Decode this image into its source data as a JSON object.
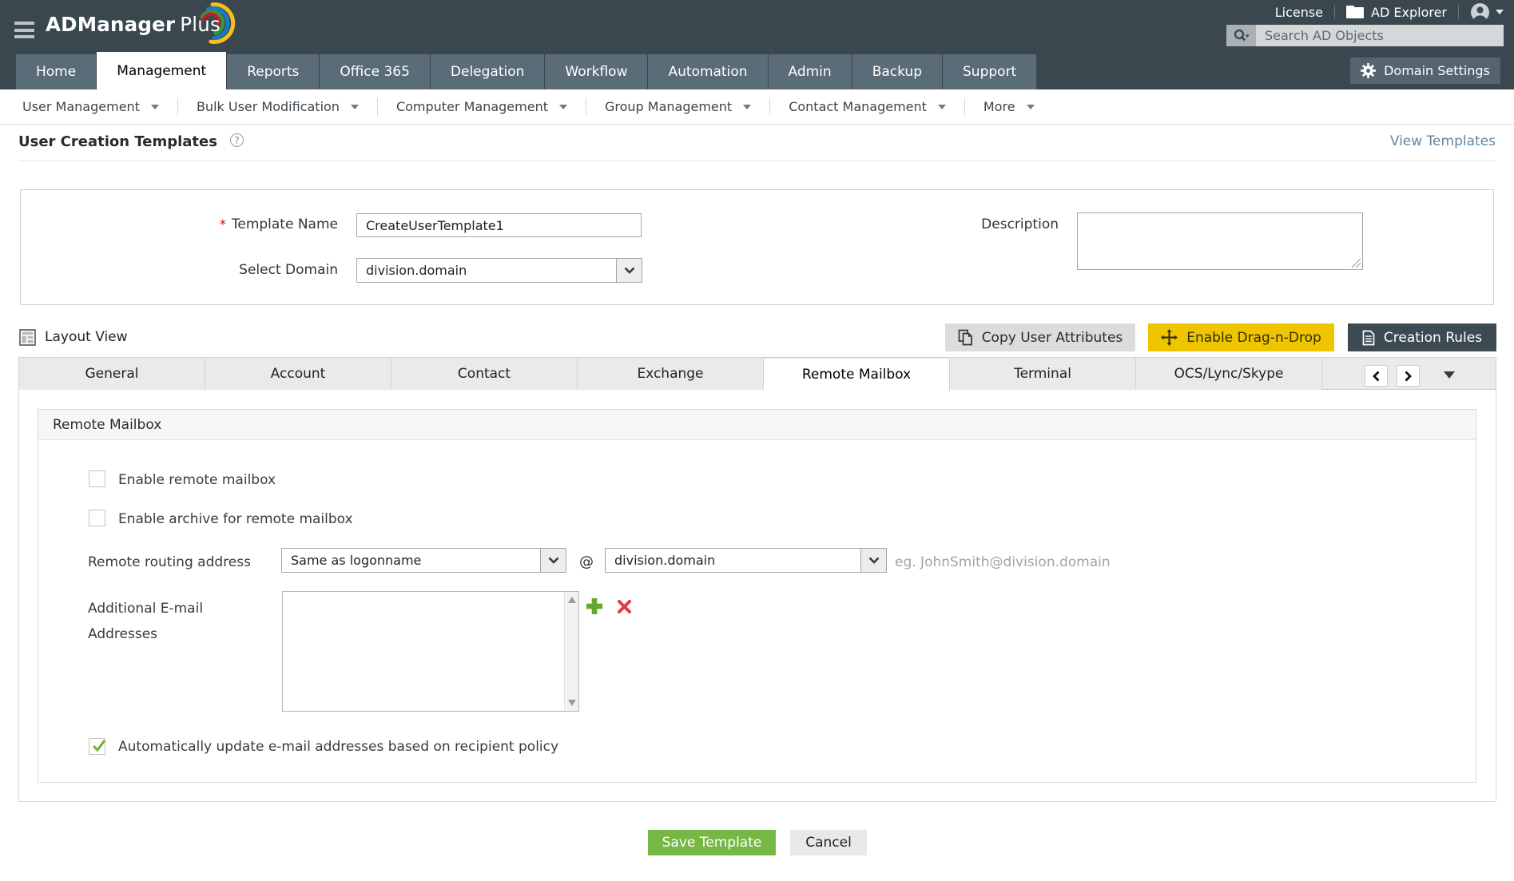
{
  "header": {
    "brand": {
      "name_bold": "ADManager",
      "name_light": "Plus"
    },
    "links": {
      "license": "License",
      "ad_explorer": "AD Explorer"
    },
    "search": {
      "placeholder": "Search AD Objects"
    }
  },
  "nav": {
    "tabs": [
      {
        "label": "Home",
        "active": false
      },
      {
        "label": "Management",
        "active": true
      },
      {
        "label": "Reports",
        "active": false
      },
      {
        "label": "Office 365",
        "active": false
      },
      {
        "label": "Delegation",
        "active": false
      },
      {
        "label": "Workflow",
        "active": false
      },
      {
        "label": "Automation",
        "active": false
      },
      {
        "label": "Admin",
        "active": false
      },
      {
        "label": "Backup",
        "active": false
      },
      {
        "label": "Support",
        "active": false
      }
    ],
    "domain_settings_label": "Domain Settings"
  },
  "subnav": {
    "items": [
      {
        "label": "User Management"
      },
      {
        "label": "Bulk User Modification"
      },
      {
        "label": "Computer Management"
      },
      {
        "label": "Group Management"
      },
      {
        "label": "Contact Management"
      },
      {
        "label": "More"
      }
    ]
  },
  "page": {
    "title": "User Creation Templates",
    "help_mark": "?",
    "view_templates_link": "View Templates"
  },
  "form": {
    "template_name": {
      "required_mark": "*",
      "label": "Template Name",
      "value": "CreateUserTemplate1"
    },
    "select_domain": {
      "label": "Select Domain",
      "value": "division.domain"
    },
    "description": {
      "label": "Description",
      "value": ""
    }
  },
  "layout_bar": {
    "layout_view_label": "Layout View",
    "copy_user_attributes_label": "Copy User Attributes",
    "enable_drag_n_drop_label": "Enable Drag-n-Drop",
    "creation_rules_label": "Creation Rules"
  },
  "template_tabs": {
    "items": [
      {
        "label": "General",
        "active": false
      },
      {
        "label": "Account",
        "active": false
      },
      {
        "label": "Contact",
        "active": false
      },
      {
        "label": "Exchange",
        "active": false
      },
      {
        "label": "Remote Mailbox",
        "active": true
      },
      {
        "label": "Terminal",
        "active": false
      },
      {
        "label": "OCS/Lync/Skype",
        "active": false
      }
    ]
  },
  "remote_mailbox": {
    "section_title": "Remote Mailbox",
    "enable_remote_mailbox": {
      "label": "Enable remote mailbox",
      "checked": false
    },
    "enable_archive": {
      "label": "Enable archive for remote mailbox",
      "checked": false
    },
    "remote_routing": {
      "label": "Remote routing address",
      "selected_option": "Same as logonname",
      "at_sign": "@",
      "selected_domain": "division.domain",
      "example": "eg. JohnSmith@division.domain"
    },
    "additional_email": {
      "label_line1": "Additional E-mail",
      "label_line2": "Addresses",
      "value": ""
    },
    "recipient_policy": {
      "label": "Automatically update e-mail addresses based on recipient policy",
      "checked": true
    }
  },
  "footer": {
    "save_label": "Save Template",
    "cancel_label": "Cancel"
  },
  "colors": {
    "header_bg": "#3a474f",
    "nav_tab_bg": "#5a6c77",
    "accent_yellow": "#efc400",
    "accent_green": "#76b843",
    "dark_button": "#3d4a52",
    "link_blue": "#5e87a5",
    "danger_red": "#e23b3b"
  }
}
